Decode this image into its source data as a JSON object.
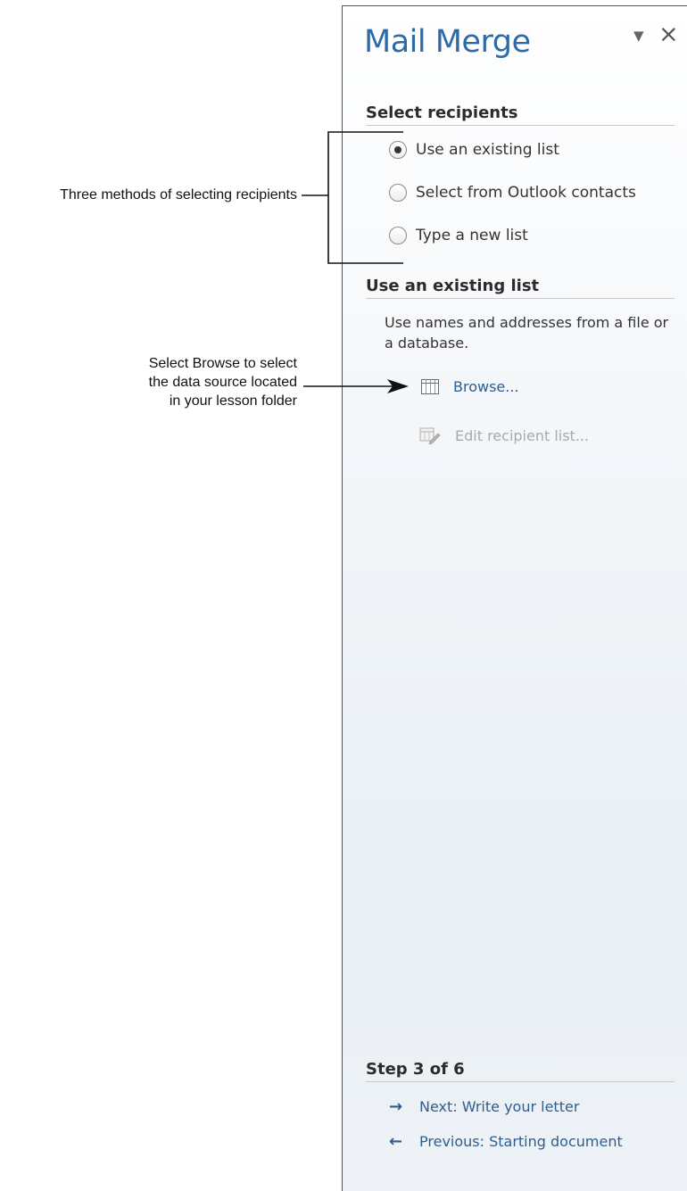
{
  "callouts": {
    "methods": "Three methods of selecting recipients",
    "browse_lines": [
      "Select Browse to select",
      "the data source located",
      "in your lesson folder"
    ]
  },
  "pane": {
    "title": "Mail Merge",
    "menu_icon": "triangle-down",
    "close_icon": "close-x",
    "select_heading": "Select recipients",
    "radios": [
      {
        "label": "Use an existing list",
        "checked": true
      },
      {
        "label": "Select from Outlook contacts",
        "checked": false
      },
      {
        "label": "Type a new list",
        "checked": false
      }
    ],
    "existing_heading": "Use an existing list",
    "existing_desc": "Use names and addresses from a file or a database.",
    "browse_label": "Browse...",
    "edit_label": "Edit recipient list...",
    "step_heading": "Step 3 of 6",
    "next_label": "Next: Write your letter",
    "prev_label": "Previous: Starting document",
    "colors": {
      "title": "#2f6aa8",
      "link": "#2f5d90",
      "disabled": "#a9a9a9"
    }
  }
}
